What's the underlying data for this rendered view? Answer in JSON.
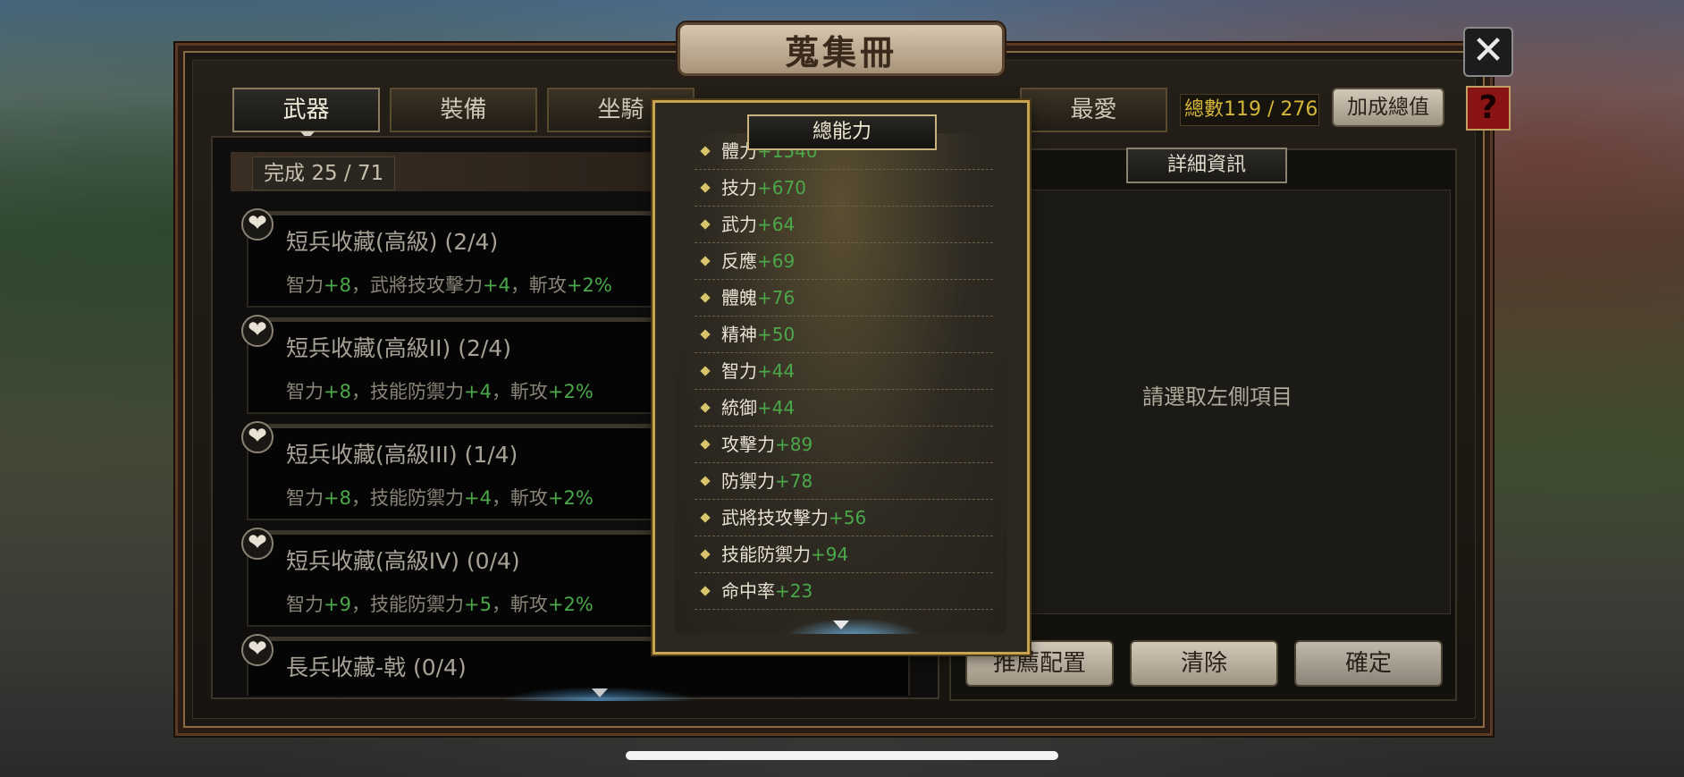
{
  "title": "蒐集冊",
  "tabs": [
    {
      "label": "武器"
    },
    {
      "label": "裝備"
    },
    {
      "label": "坐騎"
    },
    {
      "label": "最愛"
    }
  ],
  "total": {
    "label": "總數",
    "value": "119 / 276"
  },
  "bonus_button": "加成總值",
  "help_label": "?",
  "close_label": "✕",
  "completion": {
    "label": "完成",
    "value": "25 / 71"
  },
  "collection_items": [
    {
      "title": "短兵收藏(高級) (2/4)",
      "desc": [
        {
          "t": "智力",
          "v": "+8"
        },
        {
          "t": "，武將技攻擊力",
          "v": "+4"
        },
        {
          "t": "，斬攻",
          "v": "+2%"
        }
      ]
    },
    {
      "title": "短兵收藏(高級II) (2/4)",
      "desc": [
        {
          "t": "智力",
          "v": "+8"
        },
        {
          "t": "，技能防禦力",
          "v": "+4"
        },
        {
          "t": "，斬攻",
          "v": "+2%"
        }
      ]
    },
    {
      "title": "短兵收藏(高級III) (1/4)",
      "desc": [
        {
          "t": "智力",
          "v": "+8"
        },
        {
          "t": "，技能防禦力",
          "v": "+4"
        },
        {
          "t": "，斬攻",
          "v": "+2%"
        }
      ]
    },
    {
      "title": "短兵收藏(高級IV) (0/4)",
      "desc": [
        {
          "t": "智力",
          "v": "+9"
        },
        {
          "t": "，技能防禦力",
          "v": "+5"
        },
        {
          "t": "，斬攻",
          "v": "+2%"
        }
      ]
    },
    {
      "title": "長兵收藏-戟 (0/4)",
      "desc": []
    }
  ],
  "detail": {
    "header": "詳細資訊",
    "hint": "請選取左側項目"
  },
  "actions": {
    "recommend": "推薦配置",
    "clear": "清除",
    "confirm": "確定"
  },
  "stats_popup": {
    "title": "總能力",
    "stats": [
      {
        "name": "體力",
        "value": "+1540"
      },
      {
        "name": "技力",
        "value": "+670"
      },
      {
        "name": "武力",
        "value": "+64"
      },
      {
        "name": "反應",
        "value": "+69"
      },
      {
        "name": "體魄",
        "value": "+76"
      },
      {
        "name": "精神",
        "value": "+50"
      },
      {
        "name": "智力",
        "value": "+44"
      },
      {
        "name": "統御",
        "value": "+44"
      },
      {
        "name": "攻擊力",
        "value": "+89"
      },
      {
        "name": "防禦力",
        "value": "+78"
      },
      {
        "name": "武將技攻擊力",
        "value": "+56"
      },
      {
        "name": "技能防禦力",
        "value": "+94"
      },
      {
        "name": "命中率",
        "value": "+23"
      }
    ]
  },
  "colors": {
    "stat_positive": "#4aa84a",
    "total_value": "#d4b638",
    "popup_border": "#c8a450"
  }
}
